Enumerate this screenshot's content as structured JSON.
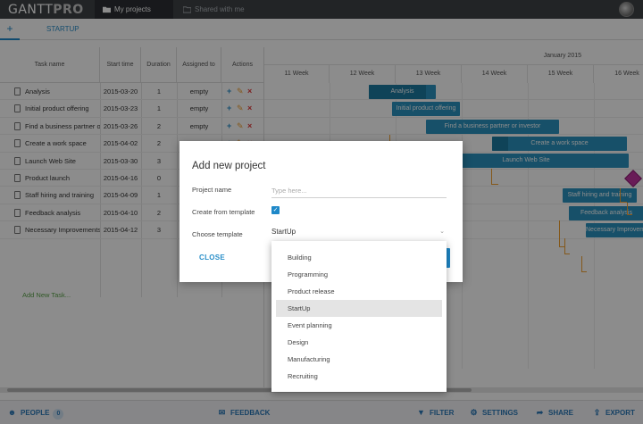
{
  "app": {
    "logo_main": "GANTT",
    "logo_accent": "PRO",
    "tabs": [
      {
        "label": "My projects",
        "icon": "folder-icon",
        "active": true
      },
      {
        "label": "Shared with me",
        "icon": "share-folder-icon",
        "active": false
      }
    ]
  },
  "project_tabs": {
    "add": "+",
    "current": "STARTUP"
  },
  "grid": {
    "headers": [
      "Task name",
      "Start time",
      "Duration",
      "Assigned to",
      "Actions"
    ],
    "rows": [
      {
        "name": "Analysis",
        "start": "2015-03-20",
        "duration": "1",
        "assigned": "empty"
      },
      {
        "name": "Initial product offering",
        "start": "2015-03-23",
        "duration": "1",
        "assigned": "empty"
      },
      {
        "name": "Find a business partner or",
        "start": "2015-03-26",
        "duration": "2",
        "assigned": "empty"
      },
      {
        "name": "Create a work space",
        "start": "2015-04-02",
        "duration": "2",
        "assigned": ""
      },
      {
        "name": "Launch Web Site",
        "start": "2015-03-30",
        "duration": "3",
        "assigned": ""
      },
      {
        "name": "Product launch",
        "start": "2015-04-16",
        "duration": "0",
        "assigned": ""
      },
      {
        "name": "Staff hiring and training",
        "start": "2015-04-09",
        "duration": "1",
        "assigned": ""
      },
      {
        "name": "Feedback analysis",
        "start": "2015-04-10",
        "duration": "2",
        "assigned": ""
      },
      {
        "name": "Necessary Improvements",
        "start": "2015-04-12",
        "duration": "3",
        "assigned": ""
      }
    ],
    "add_task": "Add New Task..."
  },
  "gantt": {
    "month": "January 2015",
    "weeks": [
      "11 Week",
      "12 Week",
      "13 Week",
      "14 Week",
      "15 Week",
      "16 Week"
    ],
    "bars": [
      {
        "label": "Analysis",
        "progress": 0.85
      },
      {
        "label": "Initial product offering",
        "progress": 0.0
      },
      {
        "label": "Find a business partner or investor",
        "progress": 0.0
      },
      {
        "label": "Create a work space",
        "progress": 0.12
      },
      {
        "label": "Launch Web Site",
        "progress": 0.0
      },
      {
        "label": "",
        "progress": 0.0
      },
      {
        "label": "Staff hiring and training",
        "progress": 0.0
      },
      {
        "label": "Feedback analysis",
        "progress": 0.0
      },
      {
        "label": "Necessary Improvements",
        "progress": 0.0
      }
    ]
  },
  "dialog": {
    "title": "Add new project",
    "project_name_label": "Project name",
    "project_name_placeholder": "Type here...",
    "template_label": "Create from template",
    "template_checked": true,
    "choose_label": "Choose template",
    "selected_template": "StartUp",
    "close": "CLOSE"
  },
  "dropdown": {
    "options": [
      "Building",
      "Programming",
      "Product release",
      "StartUp",
      "Event planning",
      "Design",
      "Manufacturing",
      "Recruiting"
    ],
    "selected": "StartUp"
  },
  "footer": {
    "people": "PEOPLE",
    "people_count": "0",
    "feedback": "FEEDBACK",
    "filter": "FILTER",
    "settings": "SETTINGS",
    "share": "SHARE",
    "export": "EXPORT"
  },
  "colors": {
    "accent": "#1e88c8",
    "bar": "#2a93bf",
    "bar_progress": "#1c7aa0",
    "link": "#f0a030",
    "milestone": "#c0349e"
  }
}
